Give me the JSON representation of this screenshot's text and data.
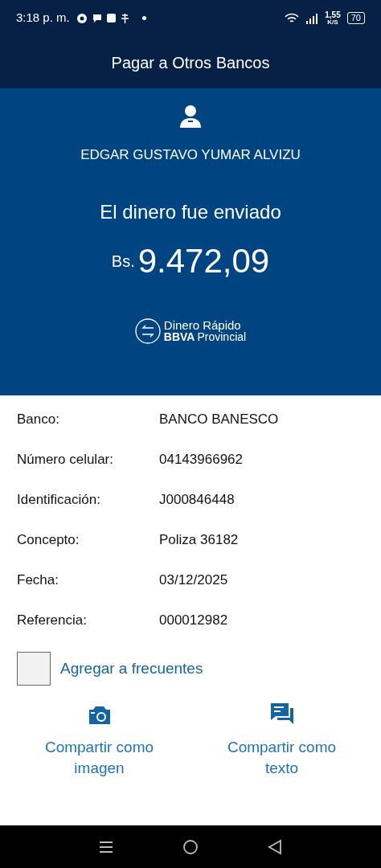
{
  "status_bar": {
    "time": "3:18 p. m.",
    "speed": "1,55",
    "speed_unit": "K/S",
    "battery": "70"
  },
  "header": {
    "title": "Pagar a Otros Bancos"
  },
  "summary": {
    "recipient": "EDGAR GUSTAVO YUMAR ALVIZU",
    "message": "El dinero fue enviado",
    "currency": "Bs.",
    "amount": "9.472,09",
    "brand_line_1": "Dinero Rápido",
    "brand_bold": "BBVA",
    "brand_rest": "Provincial"
  },
  "details": [
    {
      "label": "Banco:",
      "value": "BANCO BANESCO"
    },
    {
      "label": "Número celular:",
      "value": "04143966962"
    },
    {
      "label": "Identificación:",
      "value": "J000846448"
    },
    {
      "label": "Concepto:",
      "value": "Poliza 36182"
    },
    {
      "label": "Fecha:",
      "value": "03/12/2025"
    },
    {
      "label": "Referencia:",
      "value": "000012982"
    }
  ],
  "favorite": {
    "label": "Agregar a frecuentes",
    "checked": false
  },
  "share_actions": [
    {
      "kind": "image",
      "label": "Compartir como imagen"
    },
    {
      "kind": "text",
      "label": "Compartir como texto"
    }
  ]
}
